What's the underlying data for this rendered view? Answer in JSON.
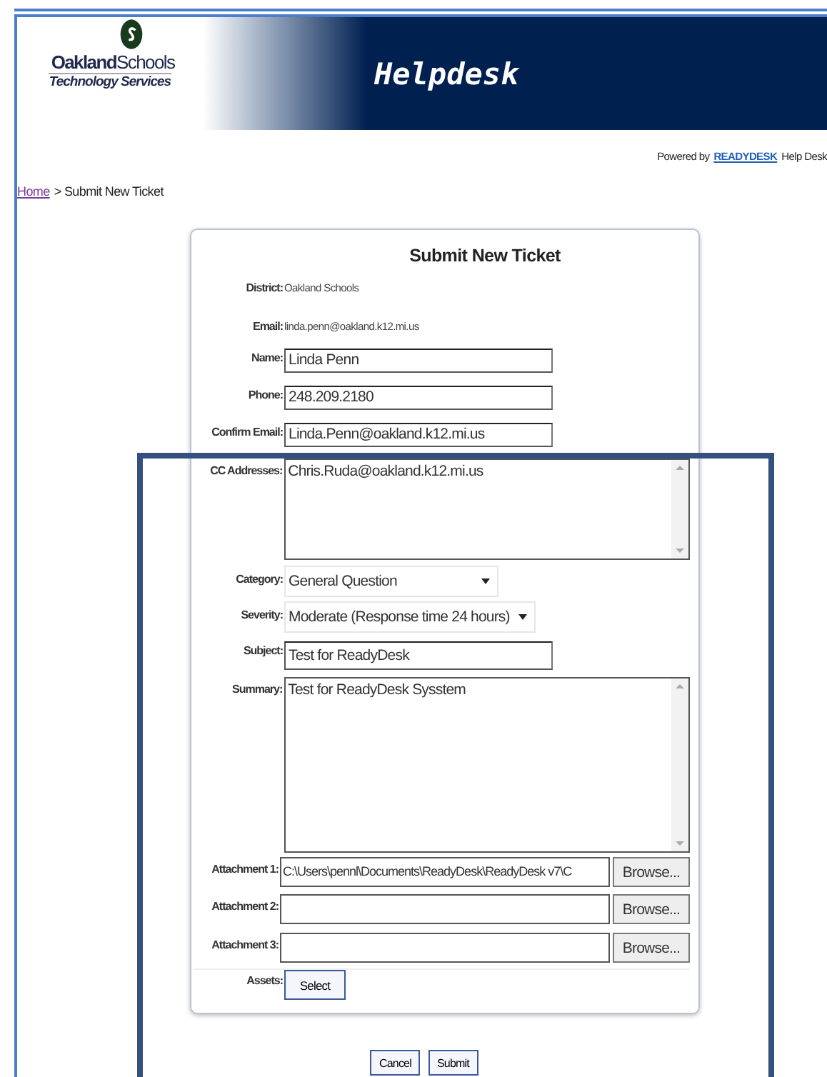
{
  "header": {
    "logo": {
      "name_bold": "Oakland",
      "name_light": "Schools",
      "subtitle": "Technology Services"
    },
    "title": "Helpdesk"
  },
  "powered_by": {
    "prefix": "Powered by",
    "link": "READYDESK",
    "suffix": "Help Desk"
  },
  "breadcrumb": {
    "home": "Home",
    "current": "> Submit New Ticket"
  },
  "form": {
    "title": "Submit New Ticket",
    "fields": [
      {
        "kind": "text",
        "label": "District:",
        "value": "Oakland Schools"
      },
      {
        "kind": "text",
        "label": "Email:",
        "value": "linda.penn@oakland.k12.mi.us"
      },
      {
        "kind": "input",
        "label": "Name:",
        "value": "Linda Penn"
      },
      {
        "kind": "input",
        "label": "Phone:",
        "value": "248.209.2180"
      },
      {
        "kind": "input",
        "label": "Confirm Email:",
        "value": "Linda.Penn@oakland.k12.mi.us"
      },
      {
        "kind": "textarea",
        "label": "CC Addresses:",
        "value": "Chris.Ruda@oakland.k12.mi.us"
      },
      {
        "kind": "select",
        "label": "Category:",
        "value": "General Question"
      },
      {
        "kind": "select",
        "label": "Severity:",
        "value": "Moderate (Response time 24 hours)"
      },
      {
        "kind": "input",
        "label": "Subject:",
        "value": "Test for ReadyDesk"
      },
      {
        "kind": "textarea",
        "label": "Summary:",
        "value": "Test for ReadyDesk Sysstem"
      },
      {
        "kind": "file",
        "label": "Attachment 1:",
        "value": "C:\\Users\\pennl\\Documents\\ReadyDesk\\ReadyDesk v7\\C",
        "button": "Browse..."
      },
      {
        "kind": "file",
        "label": "Attachment 2:",
        "button": "Browse..."
      },
      {
        "kind": "file",
        "label": "Attachment 3:",
        "button": "Browse..."
      },
      {
        "kind": "button",
        "label": "Assets:",
        "button": "Select"
      }
    ]
  },
  "buttons": [
    "Cancel",
    "Submit"
  ]
}
